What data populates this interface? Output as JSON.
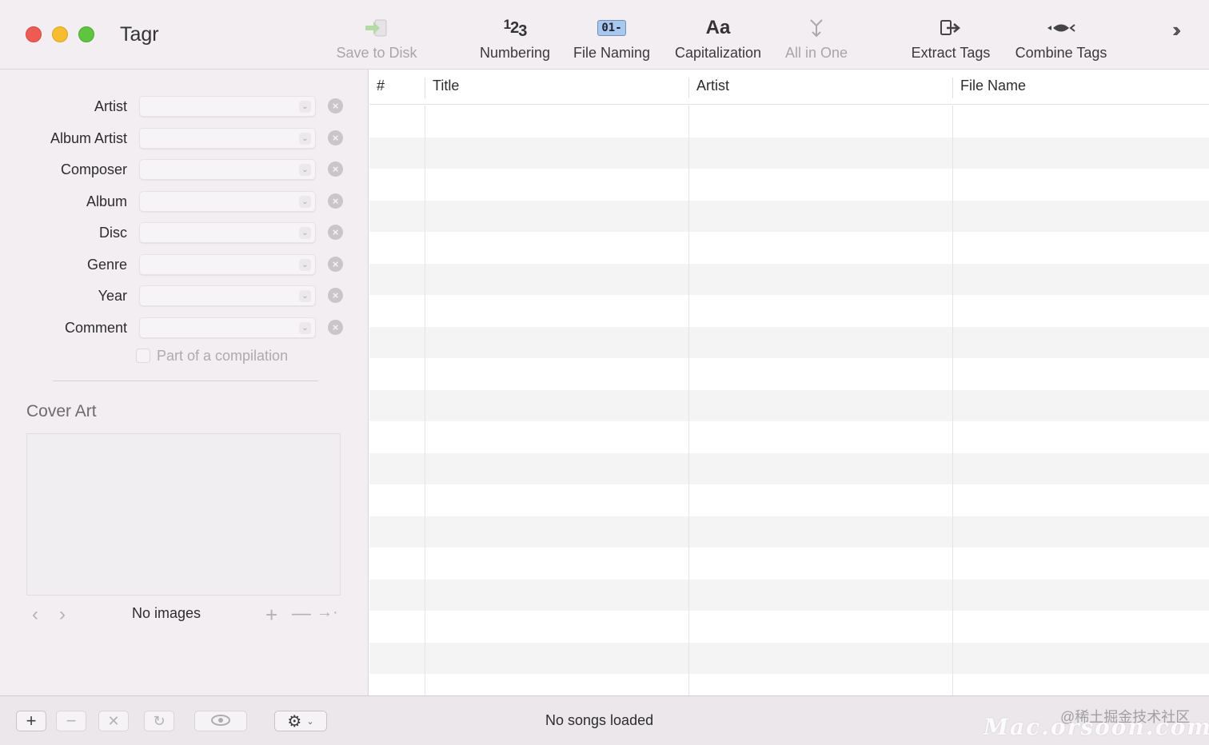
{
  "window": {
    "app_title": "Tagr"
  },
  "toolbar": {
    "items": [
      {
        "label": "Save to Disk",
        "icon": "save-to-disk-icon",
        "enabled": false
      },
      {
        "label": "Numbering",
        "icon": "numbering-icon",
        "icon_text": "123",
        "enabled": true
      },
      {
        "label": "File Naming",
        "icon": "file-naming-icon",
        "icon_text": "01-",
        "enabled": true
      },
      {
        "label": "Capitalization",
        "icon": "capitalization-icon",
        "icon_text": "Aa",
        "enabled": true
      },
      {
        "label": "All in One",
        "icon": "all-in-one-icon",
        "enabled": false
      },
      {
        "label": "Extract Tags",
        "icon": "extract-tags-icon",
        "enabled": true
      },
      {
        "label": "Combine Tags",
        "icon": "combine-tags-icon",
        "enabled": true
      }
    ],
    "overflow_icon": "chevron-double-right-icon"
  },
  "tag_fields": [
    {
      "label": "Artist",
      "value": ""
    },
    {
      "label": "Album Artist",
      "value": ""
    },
    {
      "label": "Composer",
      "value": ""
    },
    {
      "label": "Album",
      "value": ""
    },
    {
      "label": "Disc",
      "value": ""
    },
    {
      "label": "Genre",
      "value": ""
    },
    {
      "label": "Year",
      "value": ""
    },
    {
      "label": "Comment",
      "value": ""
    }
  ],
  "compilation": {
    "label": "Part of a compilation",
    "checked": false
  },
  "cover_art": {
    "title": "Cover Art",
    "status": "No images"
  },
  "table": {
    "columns": [
      "#",
      "Title",
      "Artist",
      "File Name"
    ],
    "rows": []
  },
  "status_bar": {
    "status": "No songs loaded",
    "watermark_top": "@稀土掘金技术社区",
    "watermark_bottom": "Mac.orsoon.com"
  },
  "colors": {
    "close": "#ee5b52",
    "minimize": "#f6bd30",
    "zoom": "#5fc43f",
    "save_arrow": "#6cc24a",
    "file_naming_badge": "#a9c8ee"
  }
}
